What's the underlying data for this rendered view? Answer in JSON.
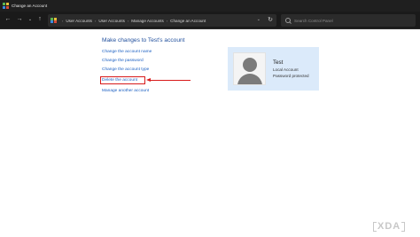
{
  "window": {
    "title": "Change an Account"
  },
  "navigation": {
    "back_icon": "arrow-left-icon",
    "forward_icon": "arrow-right-icon",
    "recent_icon": "chevron-down-icon",
    "up_icon": "arrow-up-icon",
    "breadcrumb": [
      "User Accounts",
      "User Accounts",
      "Manage Accounts",
      "Change an Account"
    ],
    "search_placeholder": "Search Control Panel"
  },
  "main": {
    "heading": "Make changes to Test's account",
    "links": [
      "Change the account name",
      "Change the password",
      "Change the account type",
      "Delete the account",
      "Manage another account"
    ],
    "highlighted_link": "Delete the account",
    "highlight_color": "#d81a1a"
  },
  "account": {
    "name": "Test",
    "type": "Local Account",
    "status": "Password protected",
    "avatar_icon": "user-icon"
  },
  "watermark": {
    "text": "XDA"
  },
  "colors": {
    "link": "#1a5fc2",
    "heading": "#1f4e9c",
    "card": "#dbeafa"
  }
}
